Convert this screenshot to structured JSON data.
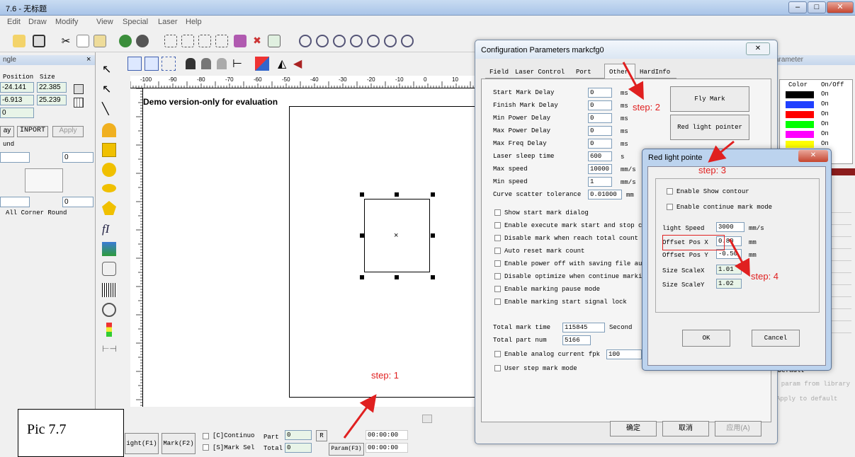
{
  "window": {
    "title": "7.6 - 无标题",
    "min_glyph": "–",
    "max_glyph": "□",
    "close_glyph": "✕"
  },
  "menu": [
    "Edit",
    "Draw",
    "Modify",
    "View",
    "Special",
    "Laser",
    "Help"
  ],
  "left_panel": {
    "title": "ngle",
    "close": "×",
    "col_position": "Position",
    "col_size": "Size",
    "x_pos": "-24.141",
    "x_size": "22.385",
    "y_pos": "-6.913",
    "y_size": "25.239",
    "z_val": "0",
    "btn_ay": "ay",
    "btn_import": "INPORT",
    "btn_apply": "Apply",
    "round_label": "und",
    "spin1": "0",
    "spin2": "0",
    "corner_round": "All Corner Round"
  },
  "canvas": {
    "demo_text": "Demo version-only for evaluation",
    "ruler_ticks": [
      "-100",
      "-90",
      "-80",
      "-70",
      "-60",
      "-50",
      "-40",
      "-30",
      "-20",
      "-10",
      "0",
      "10"
    ]
  },
  "caption": "Pic 7.7",
  "bottom_bar": {
    "light_btn": "ight(F1)",
    "mark_btn": "Mark(F2)",
    "continuo_label": "[C]Continuo",
    "part_label": "Part",
    "part_value": "0",
    "r_btn": "R",
    "time1": "00:00:00",
    "marksel_label": "[S]Mark Sel",
    "total_label": "Total",
    "total_value": "0",
    "param_btn": "Param(F3)",
    "time2": "00:00:00"
  },
  "config_dialog": {
    "title": "Configuration Parameters markcfg0",
    "close": "✕",
    "tabs": [
      "Field",
      "Laser Control",
      "Port",
      "Other",
      "HardInfo"
    ],
    "active_tab": "Other",
    "delay_rows": [
      {
        "label": "Start Mark Delay",
        "value": "0",
        "unit": "ms"
      },
      {
        "label": "Finish Mark Delay",
        "value": "0",
        "unit": "ms"
      },
      {
        "label": "Min Power Delay",
        "value": "0",
        "unit": "ms"
      },
      {
        "label": "Max Power Delay",
        "value": "0",
        "unit": "ms"
      },
      {
        "label": "Max Freq Delay",
        "value": "0",
        "unit": "ms"
      },
      {
        "label": "Laser sleep time",
        "value": "600",
        "unit": "s"
      },
      {
        "label": "Max speed",
        "value": "10000",
        "unit": "mm/s"
      },
      {
        "label": "Min speed",
        "value": "1",
        "unit": "mm/s"
      },
      {
        "label": "Curve scatter tolerance",
        "value": "0.01000",
        "unit": "mm"
      }
    ],
    "checkboxes": [
      "Show start mark dialog",
      "Enable execute mark start and stop c",
      "Disable mark when reach total count",
      "Auto reset mark count",
      "Enable power off with saving file au",
      "Disable optimize when continue marki",
      "Enable marking pause mode",
      "Enable marking start signal lock"
    ],
    "fly_mark_btn": "Fly Mark",
    "red_light_btn": "Red light pointer",
    "total_mark_time_label": "Total mark time",
    "total_mark_time_value": "115845",
    "total_mark_time_unit": "Second",
    "total_part_num_label": "Total part num",
    "total_part_num_value": "5166",
    "analog_label": "Enable analog current fpk",
    "analog_value": "100",
    "user_step_label": "User step mark mode",
    "ok_btn": "确定",
    "cancel_btn": "取消",
    "apply_btn": "应用(A)"
  },
  "red_light_dialog": {
    "title": "Red light pointe",
    "close": "✕",
    "enable_show_contour": "Enable Show contour",
    "enable_continue_mark": "Enable continue mark mode",
    "light_speed_label": "light Speed",
    "light_speed_value": "3000",
    "light_speed_unit": "mm/s",
    "offset_x_label": "Offset Pos X",
    "offset_x_value": "0.80",
    "offset_x_unit": "mm",
    "offset_y_label": "Offset Pos Y",
    "offset_y_value": "-0.50",
    "offset_y_unit": "mm",
    "scale_x_label": "Size ScaleX",
    "scale_x_value": "1.01",
    "scale_y_label": "Size ScaleY",
    "scale_y_value": "1.02",
    "ok_btn": "OK",
    "cancel_btn": "Cancel"
  },
  "right_panel": {
    "title": "arameter",
    "col_color": "Color",
    "col_onoff": "On/Off",
    "rows": [
      {
        "color": "#000000",
        "state": "On"
      },
      {
        "color": "#2040ff",
        "state": "On"
      },
      {
        "color": "#ff0000",
        "state": "On"
      },
      {
        "color": "#00ff00",
        "state": "On"
      },
      {
        "color": "#ff00ff",
        "state": "On"
      },
      {
        "color": "#ffff00",
        "state": "On"
      },
      {
        "color": "#00c0c0",
        "state": "On"
      }
    ],
    "default_label": "Default",
    "param_from_library": "t param from library",
    "apply_to_default": "Apply to default"
  },
  "steps": {
    "step1": "step: 1",
    "step2": "step: 2",
    "step3": "step: 3",
    "step4": "step: 4"
  },
  "colors": {
    "annotation": "#e02020",
    "title_bar": "#a9c4e8"
  }
}
